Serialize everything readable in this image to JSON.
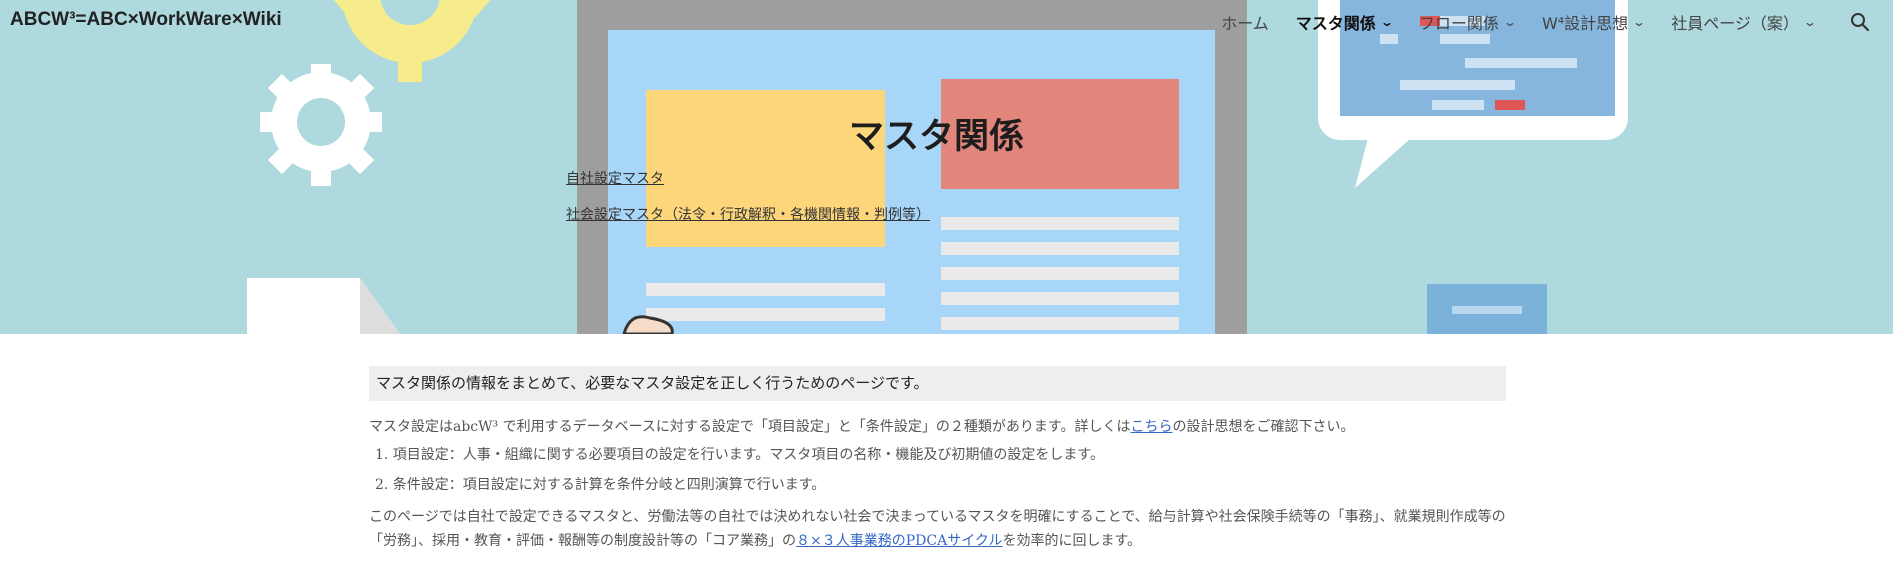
{
  "header": {
    "site_title": "ABCW³=ABC×WorkWare×Wiki",
    "nav": [
      {
        "label": "ホーム",
        "has_menu": false
      },
      {
        "label": "マスタ関係",
        "has_menu": true,
        "active": true
      },
      {
        "label": "フロー関係",
        "has_menu": true
      },
      {
        "label": "W⁴設計思想",
        "has_menu": true
      },
      {
        "label": "社員ページ（案）",
        "has_menu": true
      }
    ],
    "search_icon": "search-icon"
  },
  "hero": {
    "title": "マスタ関係",
    "links": [
      "自社設定マスタ",
      "社会設定マスタ（法令・行政解釈・各機関情報・判例等）"
    ]
  },
  "content": {
    "callout": "マスタ関係の情報をまとめて、必要なマスタ設定を正しく行うためのページです。",
    "intro_before": "マスタ設定はabcW³ で利用するデータベースに対する設定で「項目設定」と「条件設定」の２種類があります。詳しくは",
    "intro_link": "こちら",
    "intro_after": "の設計思想をご確認下さい。",
    "list": [
      "1. 項目設定：人事・組織に関する必要項目の設定を行います。マスタ項目の名称・機能及び初期値の設定をします。",
      "2. 条件設定：項目設定に対する計算を条件分岐と四則演算で行います。"
    ],
    "para_before": "このページでは自社で設定できるマスタと、労働法等の自社では決めれない社会で決まっているマスタを明確にすることで、給与計算や社会保険手続等の「事務」、就業規則作成等の「労務」、採用・教育・評価・報酬等の制度設計等の「コア業務」の",
    "para_link": "８×３人事業務のPDCAサイクル",
    "para_after": "を効率的に回します。"
  },
  "colors": {
    "hero_bg": "#add9df",
    "link": "#3567c5",
    "callout_bg": "#eeeeee"
  }
}
